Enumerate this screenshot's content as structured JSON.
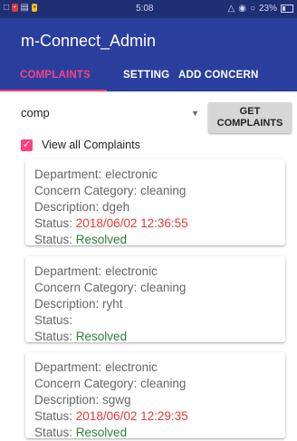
{
  "status_bar": {
    "time": "5:08",
    "battery": "23%"
  },
  "app": {
    "title": "m-Connect_Admin",
    "colors": {
      "primary": "#2a3f9d",
      "accent": "#ff4081",
      "status_date": "#e53935",
      "resolved": "#2e7d32"
    }
  },
  "tabs": [
    "COMPLAINTS",
    "SETTING",
    "ADD CONCERN"
  ],
  "controls": {
    "spinner_value": "comp",
    "get_button_line1": "GET",
    "get_button_line2": "COMPLAINTS",
    "view_all_label": "View all Complaints",
    "view_all_checked": true
  },
  "complaints": [
    {
      "department_label": "Department:",
      "department": "electronic",
      "category_label": "Concern Category:",
      "category": "cleaning",
      "description_label": "Description:",
      "description": "dgeh",
      "status_label1": "Status:",
      "status_date": "2018/06/02 12:36:55",
      "status_label2": "Status:",
      "status": "Resolved"
    },
    {
      "department_label": "Department:",
      "department": "electronic",
      "category_label": "Concern Category:",
      "category": "cleaning",
      "description_label": "Description:",
      "description": "ryht",
      "status_label1": "Status:",
      "status_date": "",
      "status_label2": "Status:",
      "status": "Resolved"
    },
    {
      "department_label": "Department:",
      "department": "electronic",
      "category_label": "Concern Category:",
      "category": "cleaning",
      "description_label": "Description:",
      "description": "sgwg",
      "status_label1": "Status:",
      "status_date": "2018/06/02 12:29:35",
      "status_label2": "Status:",
      "status": "Resolved"
    }
  ]
}
